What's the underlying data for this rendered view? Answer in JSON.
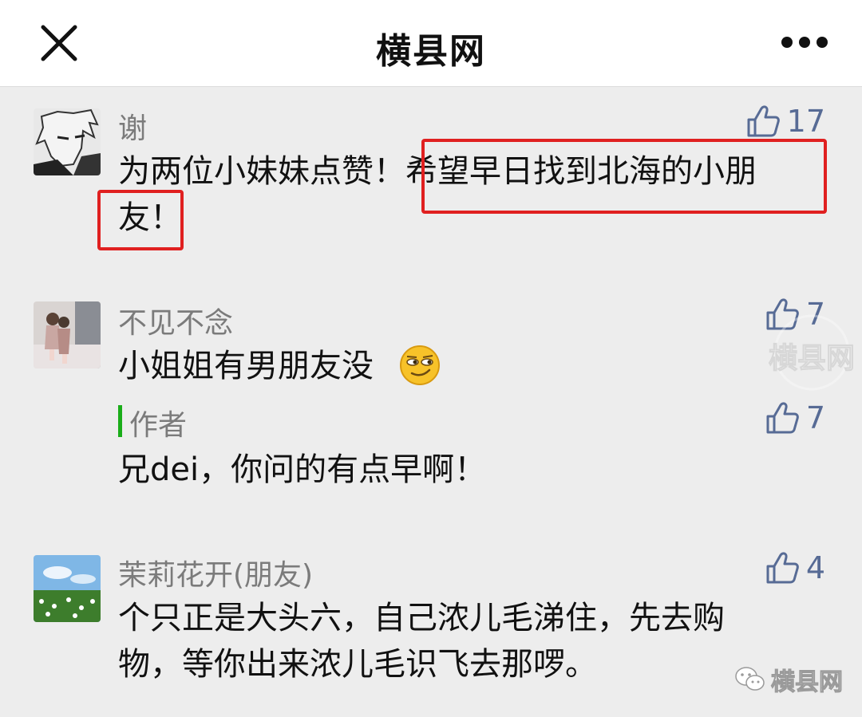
{
  "header": {
    "title": "横县网"
  },
  "comments": [
    {
      "nick": "谢",
      "likes": "17",
      "lines": [
        "为两位小妹妹点赞！希望早日找到北海的小朋",
        "友！"
      ]
    },
    {
      "nick": "不见不念",
      "likes": "7",
      "lines": [
        "小姐姐有男朋友没"
      ],
      "reply": {
        "nick": "作者",
        "likes": "7",
        "text": "兄dei，你问的有点早啊！"
      }
    },
    {
      "nick": "茉莉花开(朋友)",
      "likes": "4",
      "lines": [
        "个只正是大头六，自己浓儿毛涕住，先去购",
        "物，等你出来浓儿毛识飞去那啰。"
      ]
    }
  ],
  "watermark": {
    "seal_text": "横县网",
    "bottom_label": "横县网"
  },
  "colors": {
    "like": "#576b95",
    "highlight": "#e02020",
    "reply_bar": "#1aad19"
  },
  "icons": [
    "close-icon",
    "more-icon",
    "thumbs-up-icon",
    "smirk-emoji",
    "wechat-icon"
  ]
}
